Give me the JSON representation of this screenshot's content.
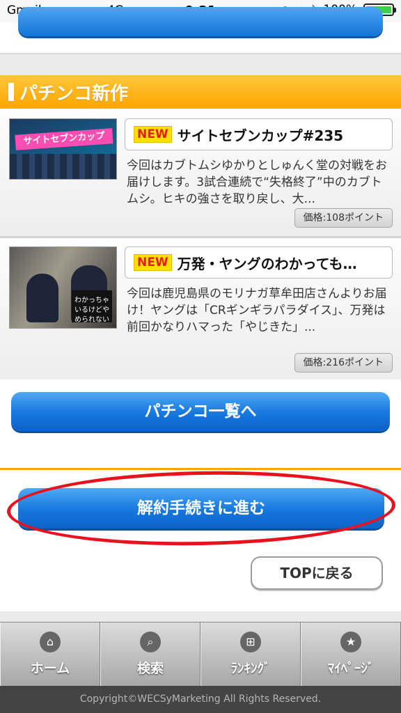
{
  "status_bar": {
    "carrier": "Gmail",
    "signal": "●●●●●",
    "network": "4G",
    "time": "9:21",
    "battery_label": "100%",
    "battery_level": 1.0
  },
  "section": {
    "title": "パチンコ新作"
  },
  "items": [
    {
      "badge": "NEW",
      "title": "サイトセブンカップ#235",
      "thumb_text": "サイトセブンカップ",
      "description": "今回はカブトムシゆかりとしゅんく堂の対戦をお届けします。3試合連続で“失格終了”中のカブトムシ。ヒキの強さを取り戻し、大...",
      "price": "価格:108ポイント"
    },
    {
      "badge": "NEW",
      "title": "万発・ヤングのわかっても…",
      "thumb_text": "わかっちゃいるけどやめられない",
      "description": "今回は鹿児島県のモリナガ草牟田店さんよりお届け！ヤングは「CRギンギラパラダイス」、万発は前回かなりハマった「やじきた」...",
      "price": "価格:216ポイント"
    }
  ],
  "buttons": {
    "pachinko_list": "パチンコ一覧へ",
    "cancel": "解約手続きに進む",
    "top": "TOPに戻る"
  },
  "nav": [
    {
      "label": "ホーム",
      "icon": "home-icon",
      "glyph": "⌂"
    },
    {
      "label": "検索",
      "icon": "search-icon",
      "glyph": "⌕"
    },
    {
      "label": "ﾗﾝｷﾝｸﾞ",
      "icon": "grid-icon",
      "glyph": "⊞"
    },
    {
      "label": "ﾏｲﾍﾟｰｼﾞ",
      "icon": "star-icon",
      "glyph": "★"
    }
  ],
  "footer": {
    "copyright": "Copyright©WECSyMarketing All Rights Reserved."
  },
  "colors": {
    "accent_orange": "#ffa500",
    "button_blue": "#1677dd",
    "annotation_red": "#e8121f"
  }
}
